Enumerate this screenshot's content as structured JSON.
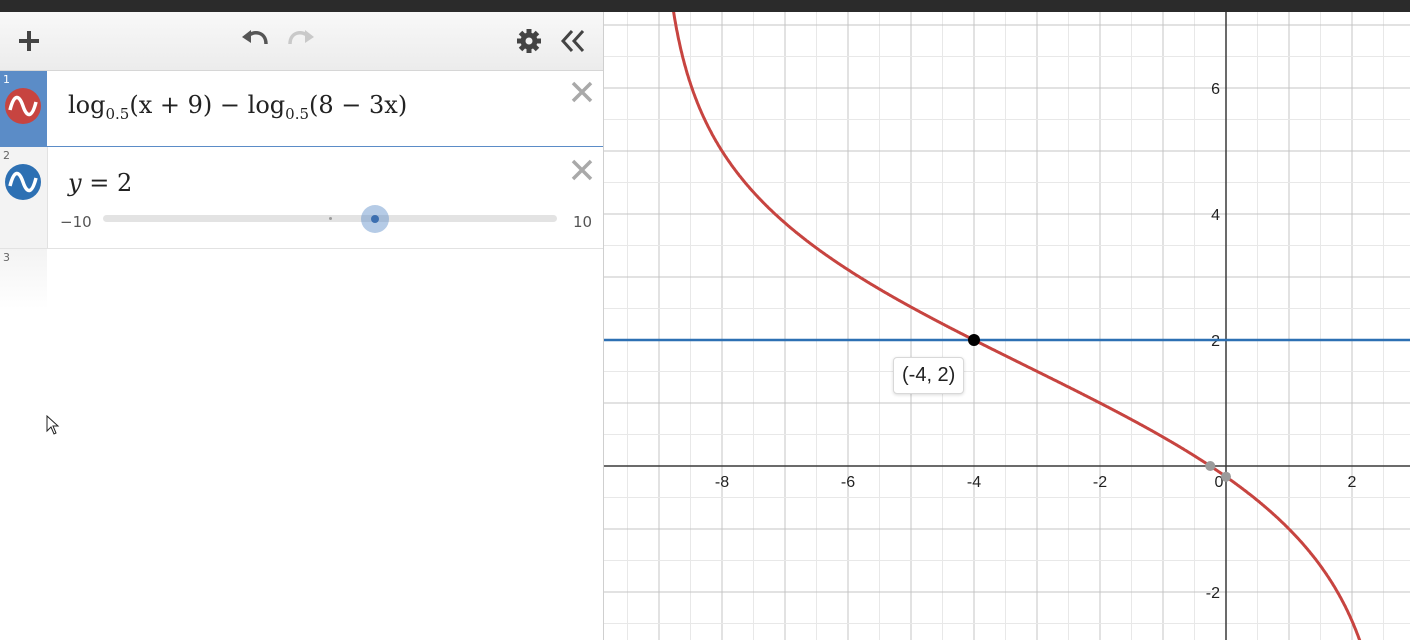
{
  "toolbar": {
    "add_icon": "plus-icon",
    "undo_icon": "undo-icon",
    "redo_icon": "redo-icon",
    "settings_icon": "gear-icon",
    "collapse_icon": "double-chevron-left-icon"
  },
  "expressions": [
    {
      "index": "1",
      "color": "#c74440",
      "selected": true,
      "log1": "log",
      "base1": "0.5",
      "arg1": "(x + 9)",
      "op": "−",
      "log2": "log",
      "base2": "0.5",
      "arg2": "(8 − 3x)"
    },
    {
      "index": "2",
      "color": "#2d70b3",
      "lhs": "y",
      "eq": " = ",
      "rhs": "2",
      "slider": {
        "min": "−10",
        "max": "10",
        "value": 2
      }
    },
    {
      "index": "3"
    }
  ],
  "graph": {
    "x_ticks": [
      "-8",
      "-6",
      "-4",
      "-2",
      "0",
      "2"
    ],
    "y_ticks": [
      "6",
      "4",
      "2",
      "-2"
    ],
    "point_label": "(-4, 2)",
    "colors": {
      "red_curve": "#c74440",
      "blue_line": "#2d70b3"
    }
  }
}
